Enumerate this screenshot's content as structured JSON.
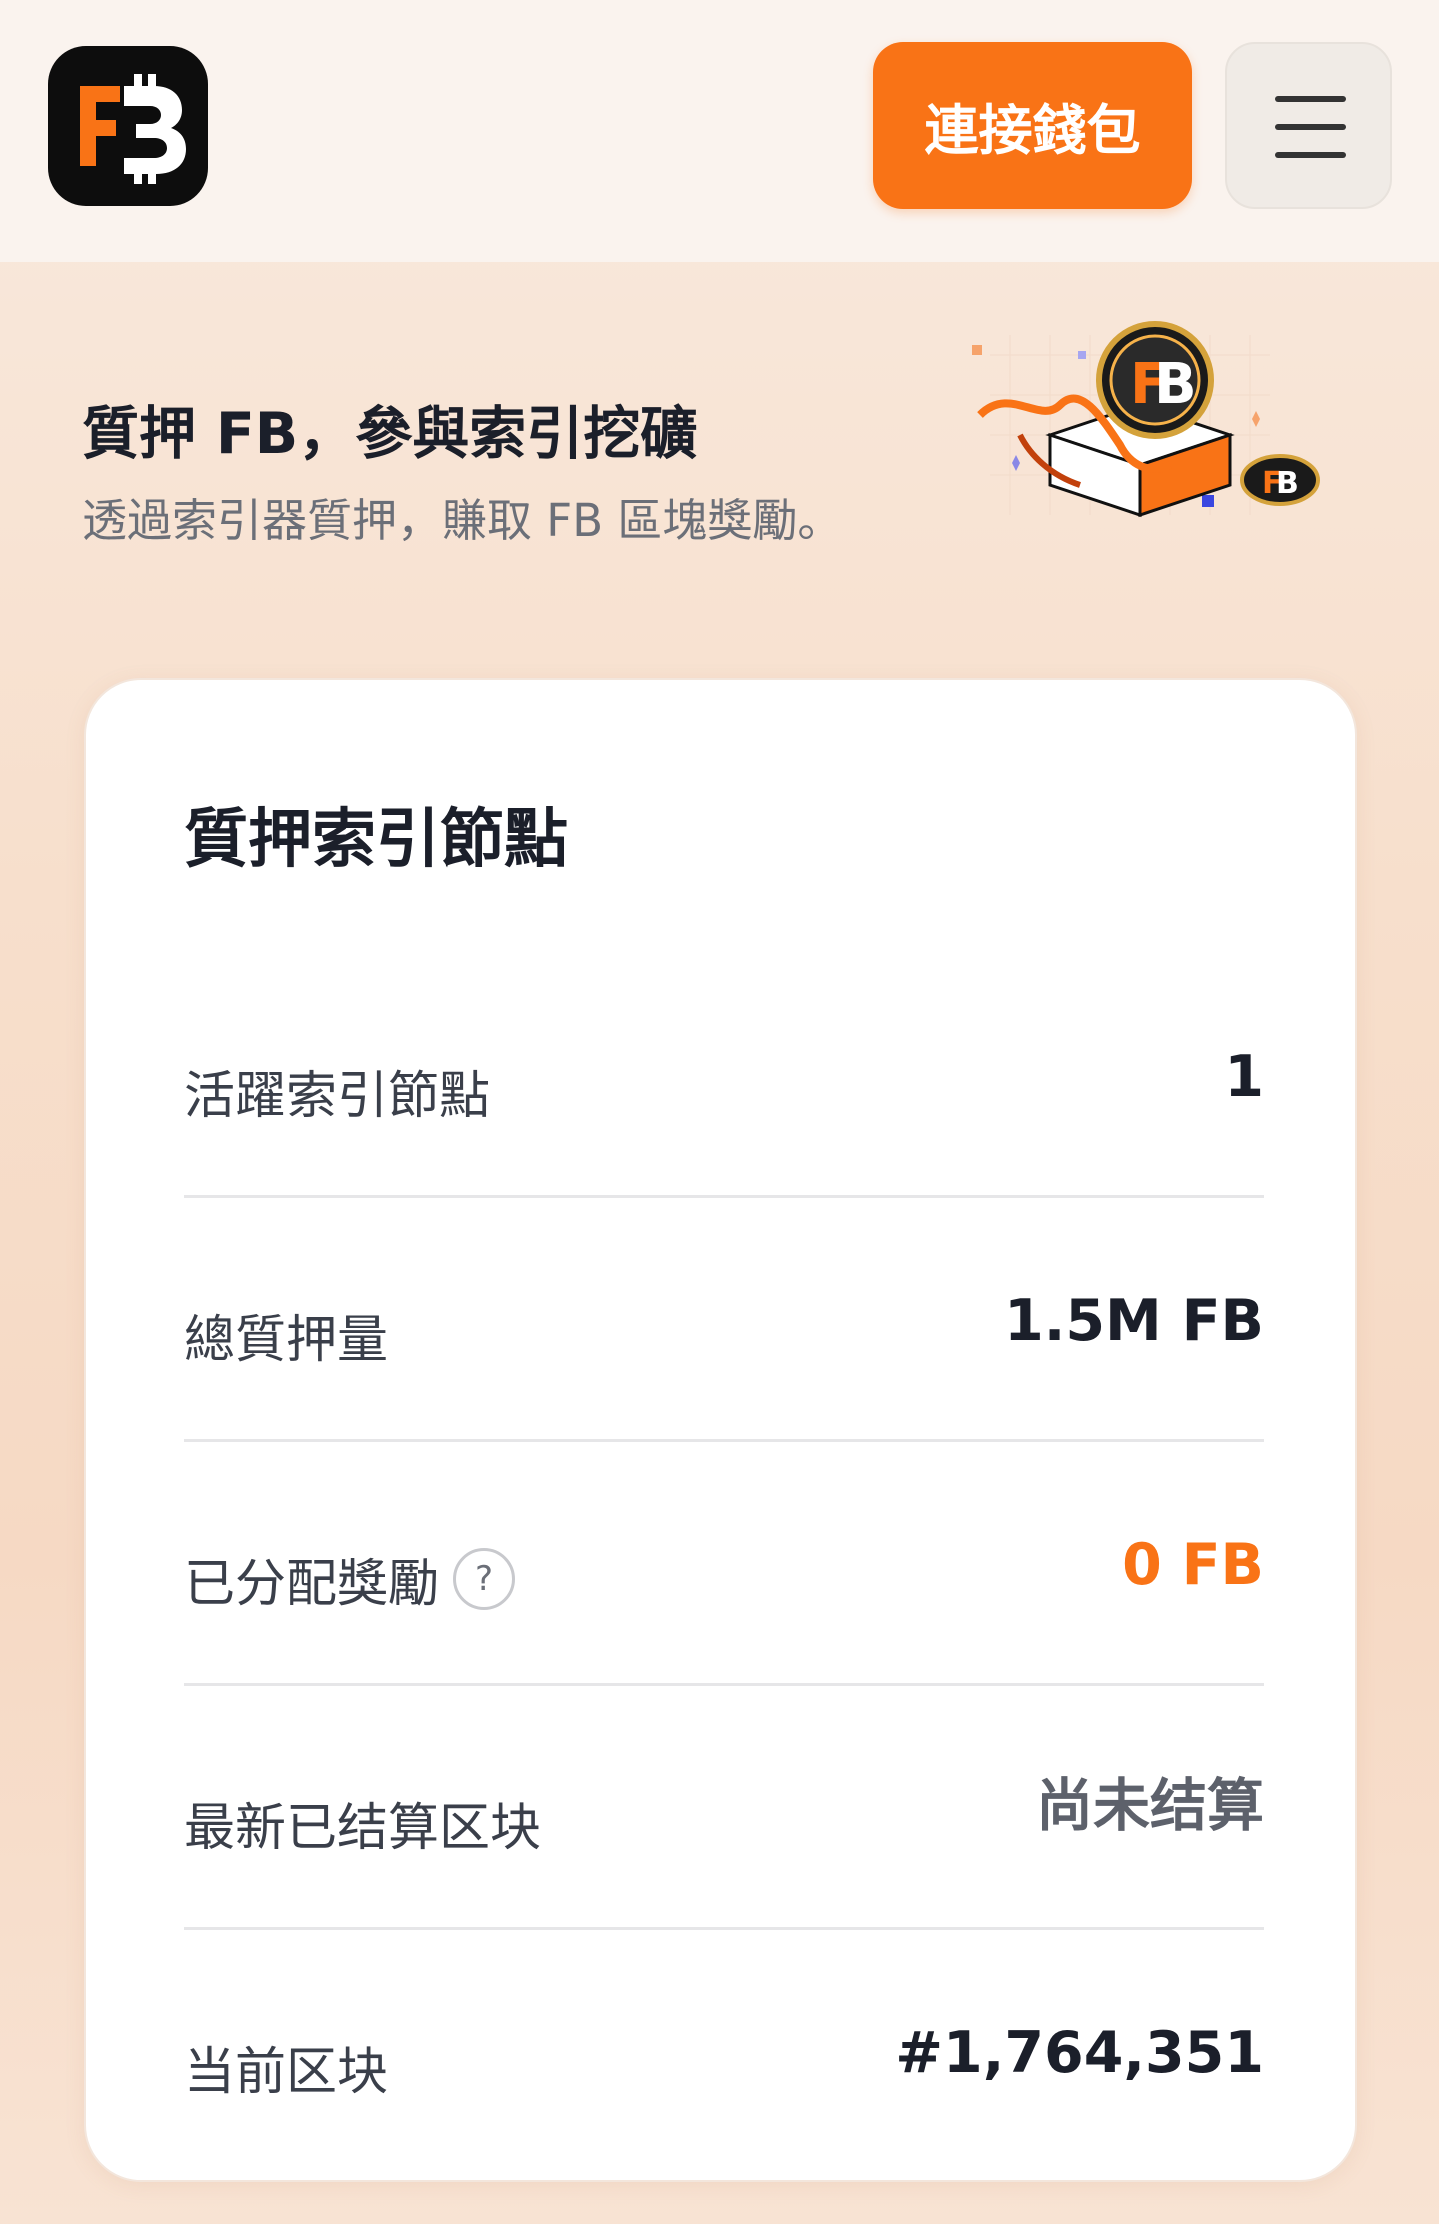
{
  "header": {
    "logo_text": "FB",
    "connect_label": "連接錢包"
  },
  "hero": {
    "title": "質押 FB，參與索引挖礦",
    "subtitle": "透過索引器質押，賺取 FB 區塊獎勵。"
  },
  "card": {
    "title": "質押索引節點",
    "rows": [
      {
        "label": "活躍索引節點",
        "value": "1"
      },
      {
        "label": "總質押量",
        "value": "1.5M FB"
      },
      {
        "label": "已分配獎勵",
        "value": "0 FB",
        "help": "?"
      },
      {
        "label": "最新已结算区块",
        "value": "尚未结算"
      },
      {
        "label": "当前区块",
        "value": "#1,764,351"
      }
    ]
  },
  "colors": {
    "accent": "#f97316",
    "text": "#1b1f2a",
    "muted": "#6b6f78"
  },
  "icons": [
    "fb-logo-icon",
    "menu-icon",
    "help-icon",
    "coin-gift-illustration"
  ]
}
